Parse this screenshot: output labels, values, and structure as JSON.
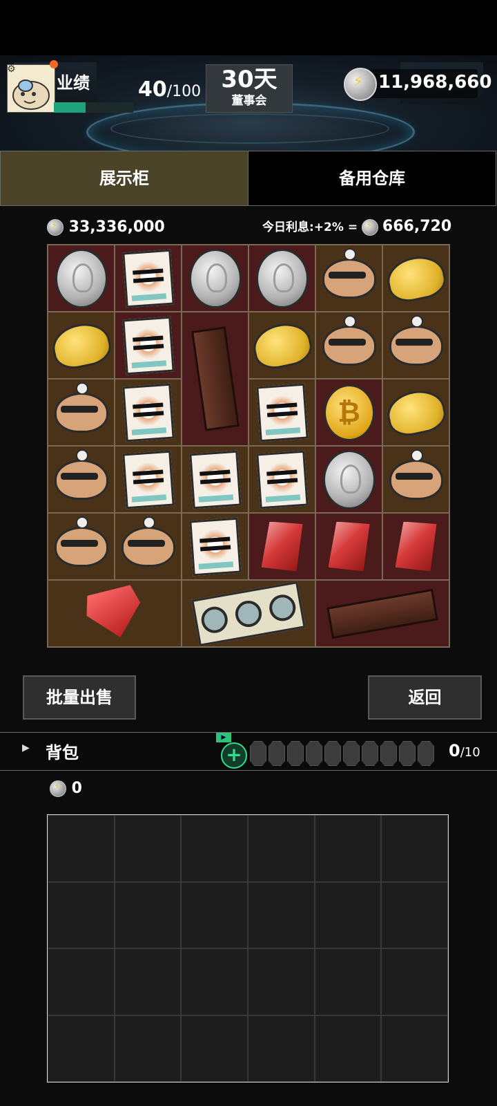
{
  "hud": {
    "performance_label": "业绩",
    "performance_current": "40",
    "performance_max": "/100",
    "performance_progress": 0.4,
    "days_value": "30天",
    "days_label": "董事会",
    "energy_total": "11,968,660"
  },
  "tabs": {
    "display": "展示柜",
    "storage": "备用仓库"
  },
  "display": {
    "total_value": "33,336,000",
    "interest_label": "今日利息:+2% =",
    "interest_value": "666,720",
    "items": [
      {
        "type": "coin",
        "bg": "r"
      },
      {
        "type": "ticket",
        "bg": "r"
      },
      {
        "type": "coin",
        "bg": "r"
      },
      {
        "type": "coin",
        "bg": "r"
      },
      {
        "type": "robot",
        "bg": "b"
      },
      {
        "type": "taco",
        "bg": "b"
      },
      {
        "type": "taco",
        "bg": "b"
      },
      {
        "type": "ticket",
        "bg": "r"
      },
      {
        "type": "tall-box",
        "bg": "r"
      },
      {
        "type": "taco",
        "bg": "b"
      },
      {
        "type": "robot",
        "bg": "b"
      },
      {
        "type": "robot",
        "bg": "b"
      },
      {
        "type": "robot",
        "bg": "b"
      },
      {
        "type": "ticket",
        "bg": "b"
      },
      {
        "type": "ticket",
        "bg": "b"
      },
      {
        "type": "btc",
        "bg": "r"
      },
      {
        "type": "taco",
        "bg": "b"
      },
      {
        "type": "robot",
        "bg": "b"
      },
      {
        "type": "ticket",
        "bg": "b"
      },
      {
        "type": "ticket",
        "bg": "b"
      },
      {
        "type": "ticket",
        "bg": "b"
      },
      {
        "type": "coin",
        "bg": "r"
      },
      {
        "type": "robot",
        "bg": "b"
      },
      {
        "type": "robot",
        "bg": "b"
      },
      {
        "type": "robot",
        "bg": "b"
      },
      {
        "type": "ticket",
        "bg": "b"
      },
      {
        "type": "gem",
        "bg": "r"
      },
      {
        "type": "gem",
        "bg": "r"
      },
      {
        "type": "gem",
        "bg": "r"
      },
      {
        "type": "diamond",
        "bg": "b"
      },
      {
        "type": "gpu",
        "bg": "b"
      },
      {
        "type": "wide-box",
        "bg": "r"
      }
    ]
  },
  "actions": {
    "sell": "批量出售",
    "back": "返回"
  },
  "bag": {
    "label": "背包",
    "ad_tag": "▶",
    "count": "0",
    "capacity": "/10",
    "coins": "0",
    "slots": 10,
    "rows": 4,
    "cols": 6
  }
}
